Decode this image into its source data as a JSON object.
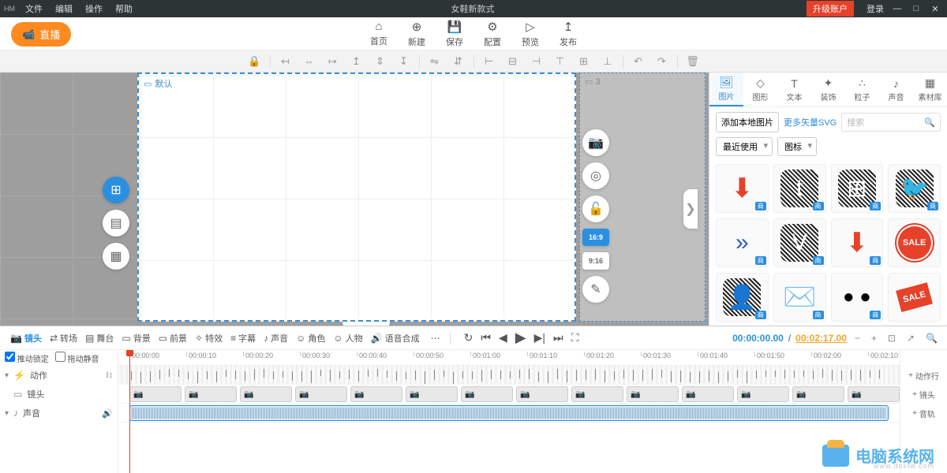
{
  "titlebar": {
    "logo": "HM",
    "menus": [
      "文件",
      "编辑",
      "操作",
      "帮助"
    ],
    "title": "女鞋新款式",
    "upgrade": "升级账户",
    "login": "登录"
  },
  "live_label": "直播",
  "nav": [
    {
      "icon": "⌂",
      "label": "首页"
    },
    {
      "icon": "⊕",
      "label": "新建"
    },
    {
      "icon": "💾",
      "label": "保存"
    },
    {
      "icon": "⚙",
      "label": "配置"
    },
    {
      "icon": "▷",
      "label": "预览"
    },
    {
      "icon": "↥",
      "label": "发布"
    }
  ],
  "canvas": {
    "main_tag": "默认",
    "next_tag": "3",
    "ratios": [
      "16:9",
      "9:16"
    ]
  },
  "right_panel": {
    "tabs": [
      {
        "icon": "🖼",
        "label": "图片"
      },
      {
        "icon": "◇",
        "label": "图形"
      },
      {
        "icon": "T",
        "label": "文本"
      },
      {
        "icon": "✦",
        "label": "装饰"
      },
      {
        "icon": "∴",
        "label": "粒子"
      },
      {
        "icon": "♪",
        "label": "声音"
      },
      {
        "icon": "▦",
        "label": "素材库"
      }
    ],
    "add_local": "添加本地图片",
    "more_svg": "更多矢量SVG",
    "search_placeholder": "搜索",
    "recent": "最近使用",
    "category": "图标",
    "asset_badge": "商"
  },
  "timeline": {
    "tabs": [
      {
        "icon": "📷",
        "label": "镜头"
      },
      {
        "icon": "⇄",
        "label": "转场"
      },
      {
        "icon": "▤",
        "label": "舞台"
      },
      {
        "icon": "▭",
        "label": "背景"
      },
      {
        "icon": "▭",
        "label": "前景"
      },
      {
        "icon": "✧",
        "label": "特效"
      },
      {
        "icon": "≡",
        "label": "字幕"
      },
      {
        "icon": "♪",
        "label": "声音"
      },
      {
        "icon": "☺",
        "label": "角色"
      },
      {
        "icon": "☺",
        "label": "人物"
      },
      {
        "icon": "🔊",
        "label": "语音合成"
      }
    ],
    "current_time": "00:00:00.00",
    "total_time": "00:02:17.00",
    "lock_scroll": "推动锁定",
    "drag_mute": "拖动静音",
    "tracks": {
      "action": "动作",
      "scene": "镜头",
      "audio": "声音"
    },
    "add_buttons": {
      "action": "动作行",
      "scene": "镜头",
      "audio": "音轨"
    },
    "ruler_ticks": [
      "00:00:00",
      "00:00:10",
      "00:00:20",
      "00:00:30",
      "00:00:40",
      "00:00:50",
      "00:01:00",
      "00:01:10",
      "00:01:20",
      "00:01:30",
      "00:01:40",
      "00:01:50",
      "00:02:00",
      "00:02:10"
    ]
  },
  "watermark": {
    "text": "电脑系统网",
    "url": "www.dnxtw.com"
  }
}
